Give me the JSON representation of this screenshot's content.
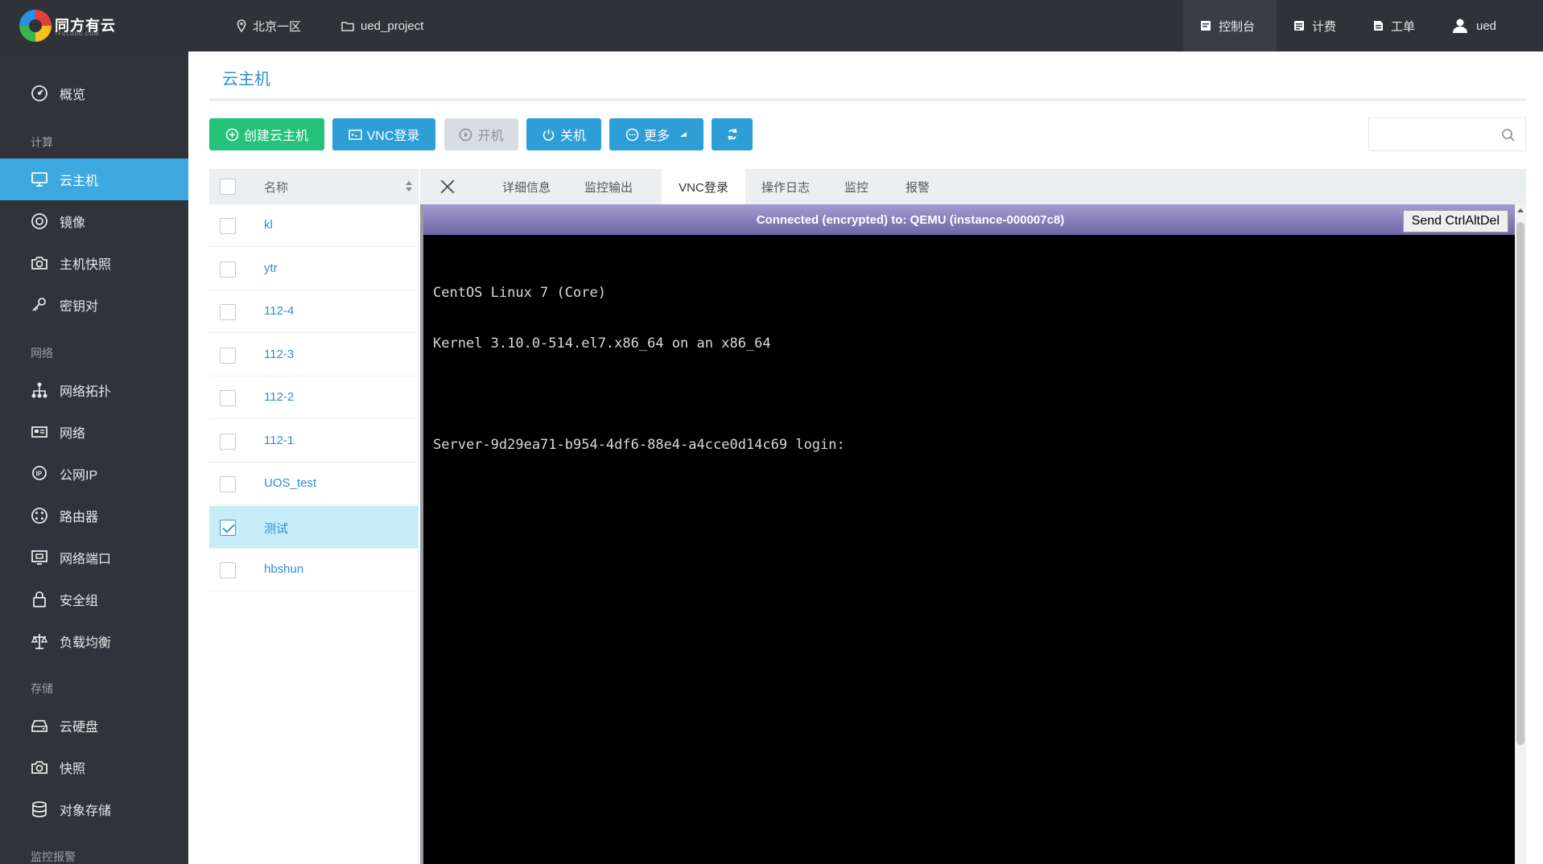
{
  "brand": {
    "name": "同方有云",
    "sub": "TFCLOUD.COM"
  },
  "topbar": {
    "region": "北京一区",
    "project": "ued_project",
    "right": [
      {
        "label": "控制台",
        "icon": "console-icon",
        "active": true
      },
      {
        "label": "计费",
        "icon": "billing-icon",
        "active": false
      },
      {
        "label": "工单",
        "icon": "ticket-icon",
        "active": false
      },
      {
        "label": "ued",
        "icon": "user-icon",
        "active": false
      }
    ]
  },
  "sidebar": {
    "overview": "概览",
    "cat_compute": "计算",
    "compute": [
      "云主机",
      "镜像",
      "主机快照",
      "密钥对"
    ],
    "cat_network": "网络",
    "network": [
      "网络拓扑",
      "网络",
      "公网IP",
      "路由器",
      "网络端口",
      "安全组",
      "负载均衡"
    ],
    "cat_storage": "存储",
    "storage": [
      "云硬盘",
      "快照",
      "对象存储"
    ],
    "cat_monitor": "监控报警"
  },
  "page": {
    "title": "云主机"
  },
  "toolbar": {
    "create": "创建云主机",
    "vnc": "VNC登录",
    "start": "开机",
    "stop": "关机",
    "more": "更多"
  },
  "search": {
    "placeholder": ""
  },
  "list": {
    "header": "名称",
    "rows": [
      {
        "name": "kl",
        "checked": false
      },
      {
        "name": "ytr",
        "checked": false
      },
      {
        "name": "112-4",
        "checked": false
      },
      {
        "name": "112-3",
        "checked": false
      },
      {
        "name": "112-2",
        "checked": false
      },
      {
        "name": "112-1",
        "checked": false
      },
      {
        "name": "UOS_test",
        "checked": false
      },
      {
        "name": "测试",
        "checked": true
      },
      {
        "name": "hbshun",
        "checked": false
      }
    ]
  },
  "tabs": [
    "详细信息",
    "监控输出",
    "VNC登录",
    "操作日志",
    "监控",
    "报警"
  ],
  "active_tab": "VNC登录",
  "vnc": {
    "status": "Connected (encrypted) to: QEMU (instance-000007c8)",
    "send_btn": "Send CtrlAltDel",
    "lines": [
      "CentOS Linux 7 (Core)",
      "Kernel 3.10.0-514.el7.x86_64 on an x86_64",
      "",
      "Server-9d29ea71-b954-4df6-88e4-a4cce0d14c69 login:"
    ]
  },
  "colors": {
    "accent": "#3da9e0",
    "green": "#23c37a",
    "button_blue": "#2d9ed6",
    "sidebar_bg": "#30343a",
    "topbar_bg": "#2f3237"
  }
}
